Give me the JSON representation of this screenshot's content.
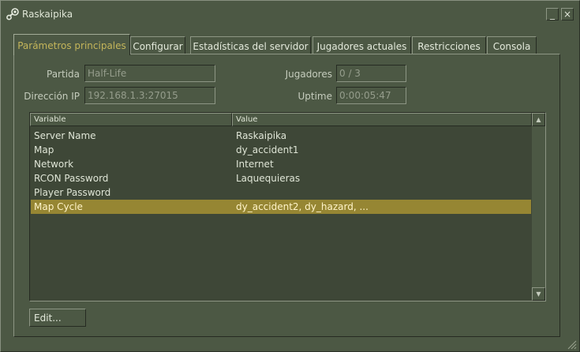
{
  "window": {
    "title": "Raskaipika",
    "icon": "steam-icon",
    "minimize_glyph": "_",
    "close_glyph": "×"
  },
  "tabs": [
    {
      "label": "Parámetros principales",
      "active": true
    },
    {
      "label": "Configurar"
    },
    {
      "label": "Estadísticas del servidor"
    },
    {
      "label": "Jugadores actuales"
    },
    {
      "label": "Restricciones"
    },
    {
      "label": "Consola"
    }
  ],
  "fields": {
    "partida": {
      "label": "Partida",
      "value": "Half-Life"
    },
    "direccion_ip": {
      "label": "Dirección IP",
      "value": "192.168.1.3:27015"
    },
    "jugadores": {
      "label": "Jugadores",
      "value": "0 / 3"
    },
    "uptime": {
      "label": "Uptime",
      "value": "0:00:05:47"
    }
  },
  "table": {
    "columns": [
      "Variable",
      "Value"
    ],
    "rows": [
      {
        "variable": "Server Name",
        "value": "Raskaipika"
      },
      {
        "variable": "Map",
        "value": "dy_accident1"
      },
      {
        "variable": "Network",
        "value": "Internet"
      },
      {
        "variable": "RCON Password",
        "value": "Laquequieras"
      },
      {
        "variable": "Player Password",
        "value": ""
      },
      {
        "variable": "Map Cycle",
        "value": "dy_accident2, dy_hazard, ...",
        "selected": true
      }
    ]
  },
  "buttons": {
    "edit": "Edit..."
  },
  "colors": {
    "background": "#4c5844",
    "list_background": "#3e4737",
    "accent_tab": "#c4b55a",
    "selection": "#968633"
  }
}
